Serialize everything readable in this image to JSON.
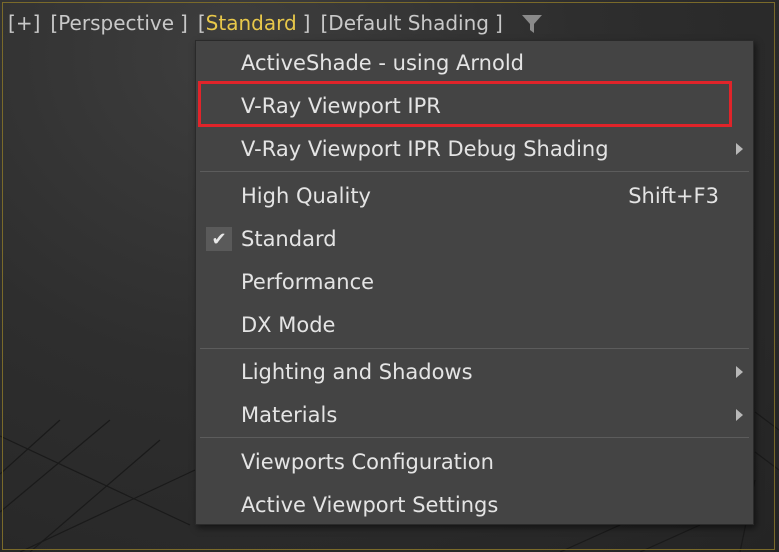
{
  "viewport_labels": {
    "plus": "+",
    "view": "Perspective",
    "mode": "Standard",
    "shading": "Default Shading",
    "open_bracket": "[",
    "close_bracket": "]"
  },
  "icons": {
    "filter": "filter-icon",
    "check": "checkmark-icon",
    "submenu": "chevron-right-icon"
  },
  "colors": {
    "active_label": "#e8c84a",
    "highlight_box": "#e0242a",
    "menu_bg": "#444444",
    "viewport_border": "#7a6a2a"
  },
  "menu": {
    "items": [
      {
        "label": "ActiveShade - using Arnold"
      },
      {
        "label": "V-Ray Viewport IPR"
      },
      {
        "label": "V-Ray Viewport IPR Debug Shading"
      },
      {
        "label": "High Quality",
        "shortcut": "Shift+F3"
      },
      {
        "label": "Standard",
        "check": "✔"
      },
      {
        "label": "Performance"
      },
      {
        "label": "DX Mode"
      },
      {
        "label": "Lighting and Shadows"
      },
      {
        "label": "Materials"
      },
      {
        "label": "Viewports Configuration"
      },
      {
        "label": "Active Viewport Settings"
      }
    ]
  }
}
